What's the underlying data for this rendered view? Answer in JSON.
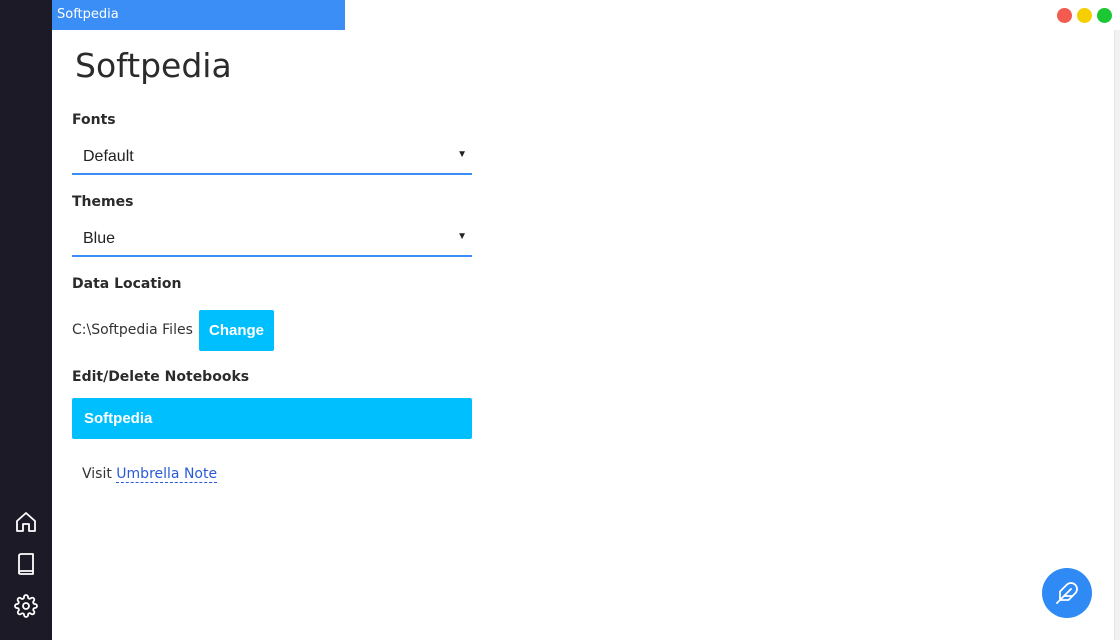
{
  "tab": {
    "title": "Softpedia"
  },
  "page": {
    "title": "Softpedia"
  },
  "fonts": {
    "label": "Fonts",
    "selected": "Default"
  },
  "themes": {
    "label": "Themes",
    "selected": "Blue"
  },
  "data_location": {
    "label": "Data Location",
    "path": "C:\\Softpedia Files",
    "change_label": "Change"
  },
  "notebooks": {
    "label": "Edit/Delete Notebooks",
    "items": [
      {
        "name": "Softpedia"
      }
    ]
  },
  "visit": {
    "prefix": "Visit",
    "link_text": "Umbrella Note"
  },
  "sidebar": {
    "icons": [
      "home-icon",
      "book-icon",
      "gear-icon"
    ]
  },
  "fab": {
    "icon": "feather-icon"
  },
  "colors": {
    "accent": "#3a8ef6",
    "button": "#00bfff",
    "sidebar_bg": "#1c1a26",
    "close": "#f35b4f",
    "minimize": "#f5cf00",
    "maximize": "#1bc732"
  }
}
